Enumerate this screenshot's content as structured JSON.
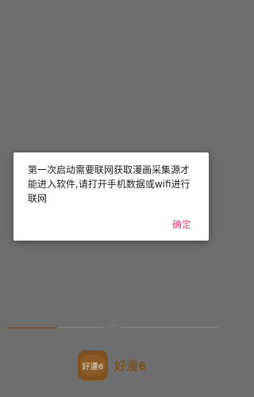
{
  "splash": {
    "progress_text": "24%",
    "progress_value": 0.24,
    "app_name": "好漫6",
    "logo_text": "好漫6",
    "brand_color": "#7e5121"
  },
  "dialog": {
    "message": "第一次启动需要联网获取漫画采集源才能进入软件,请打开手机数据或wifi进行联网",
    "confirm_label": "确定",
    "accent_color": "#e0457b"
  }
}
